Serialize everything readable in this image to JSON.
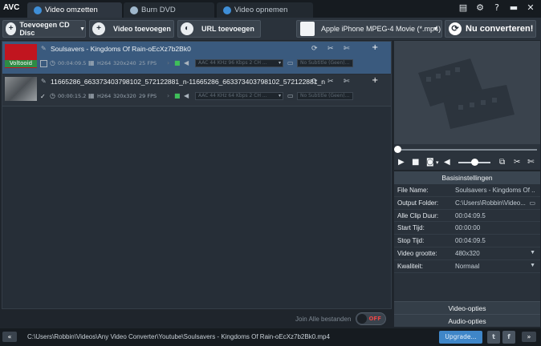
{
  "app": {
    "logo": "AVC"
  },
  "tabs": [
    {
      "label": "Video omzetten",
      "active": true
    },
    {
      "label": "Burn DVD",
      "active": false
    },
    {
      "label": "Video opnemen",
      "active": false
    }
  ],
  "toolbar": {
    "add_cd": "Toevoegen CD Disc",
    "add_video": "Video toevoegen",
    "add_url": "URL toevoegen",
    "format": "Apple iPhone MPEG-4 Movie (*.mp4)",
    "convert": "Nu converteren!"
  },
  "files": [
    {
      "name": "Soulsavers - Kingdoms Of Rain-oEcXz7b2Bk0",
      "status": "Voltooid",
      "duration": "00:04:09.5",
      "codec": "H264",
      "size": "320x240",
      "fps": "25 FPS",
      "audio": "AAC 44 KHz 96 Kbps 2 CH ...",
      "subtitle": "No Subtitle (Geen)..."
    },
    {
      "name": "11665286_663373403798102_572122881_n-11665286_663373403798102_572122881_n",
      "status": "",
      "duration": "00:00:15.2",
      "codec": "H264",
      "size": "320x320",
      "fps": "29 FPS",
      "audio": "AAC 44 KHz 64 Kbps 2 CH ...",
      "subtitle": "No Subtitle (Geen)..."
    }
  ],
  "join": {
    "label": "Join Alle bestanden",
    "state": "OFF"
  },
  "settings": {
    "header": "Basisinstellingen",
    "rows": [
      {
        "label": "File Name:",
        "value": "Soulsavers - Kingdoms Of ..."
      },
      {
        "label": "Output Folder:",
        "value": "C:\\Users\\Robbin\\Video..."
      },
      {
        "label": "Alle Clip Duur:",
        "value": "00:04:09.5"
      },
      {
        "label": "Start Tijd:",
        "value": "00:00:00"
      },
      {
        "label": "Stop Tijd:",
        "value": "00:04:09.5"
      },
      {
        "label": "Video grootte:",
        "value": "480x320"
      },
      {
        "label": "Kwaliteit:",
        "value": "Normaal"
      }
    ],
    "video_options": "Video-opties",
    "audio_options": "Audio-opties"
  },
  "status": {
    "path": "C:\\Users\\Robbin\\Videos\\Any Video Converter\\Youtube\\Soulsavers - Kingdoms Of Rain-oEcXz7b2Bk0.mp4",
    "upgrade": "Upgrade..."
  }
}
